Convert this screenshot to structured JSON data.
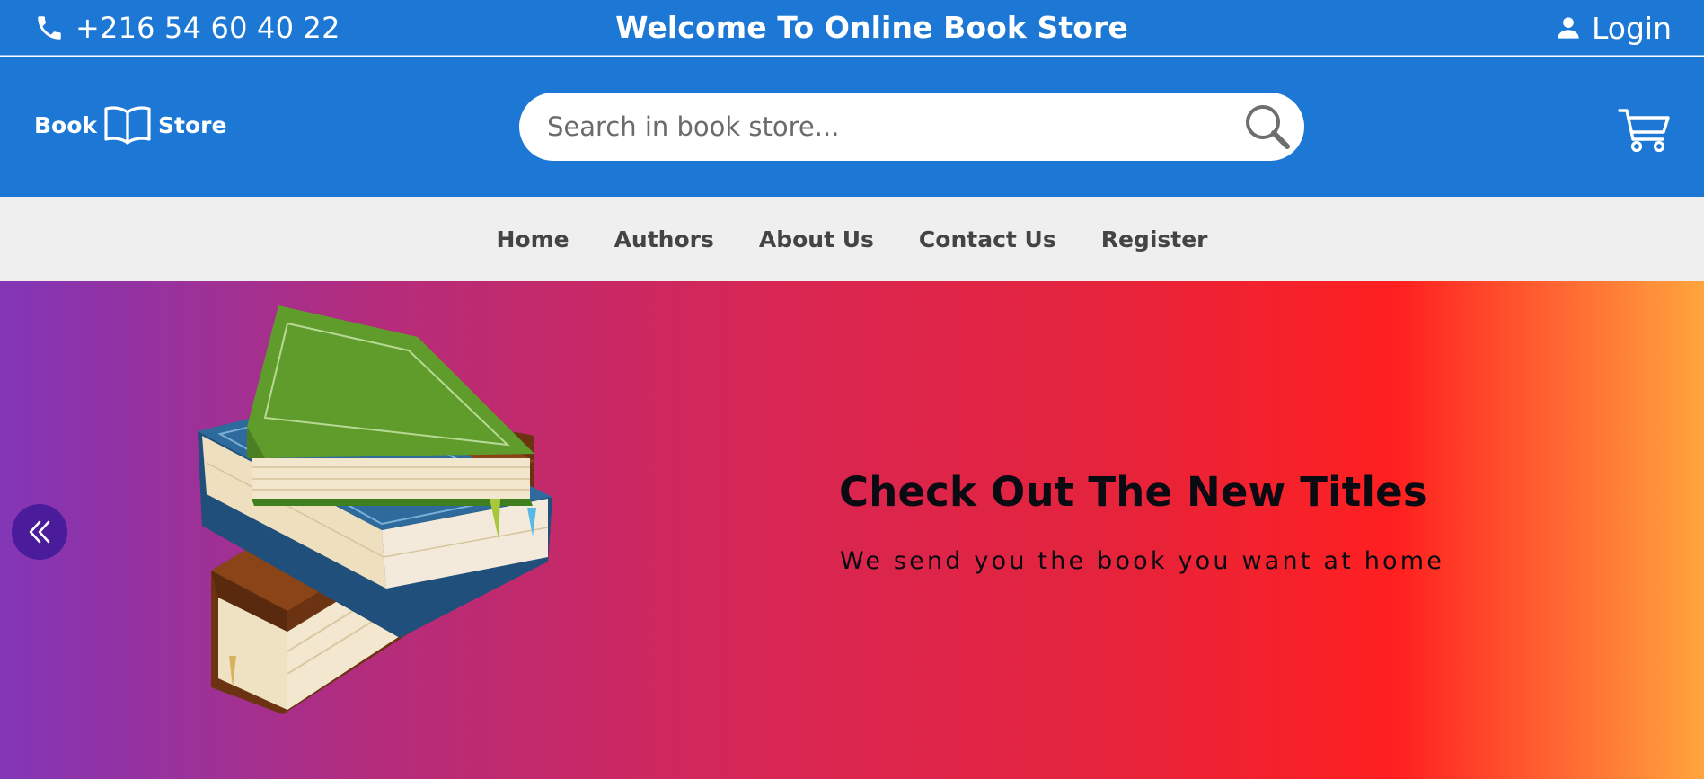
{
  "topbar": {
    "phone_icon": "phone-icon",
    "phone": "+216 54 60 40 22",
    "welcome": "Welcome To Online Book Store",
    "login_icon": "user-icon",
    "login": "Login"
  },
  "header": {
    "logo": {
      "left": "Book",
      "icon": "open-book-icon",
      "right": "Store"
    },
    "search": {
      "placeholder": "Search in book store...",
      "icon": "search-icon"
    },
    "cart_icon": "cart-icon"
  },
  "nav": {
    "items": [
      {
        "label": "Home"
      },
      {
        "label": "Authors"
      },
      {
        "label": "About Us"
      },
      {
        "label": "Contact Us"
      },
      {
        "label": "Register"
      }
    ]
  },
  "hero": {
    "prev_icon": "double-chevron-left-icon",
    "image": "stacked-books-illustration",
    "title": "Check Out The New Titles",
    "subtitle": "We send you the book you want at home"
  },
  "colors": {
    "header_blue": "#1c78d4",
    "nav_bg": "#efefef",
    "nav_text": "#444444",
    "hero_gradient": [
      "#8236b6",
      "#d72654",
      "#ff2020",
      "#ffa53d"
    ],
    "prev_button": "#4a1b9a"
  }
}
